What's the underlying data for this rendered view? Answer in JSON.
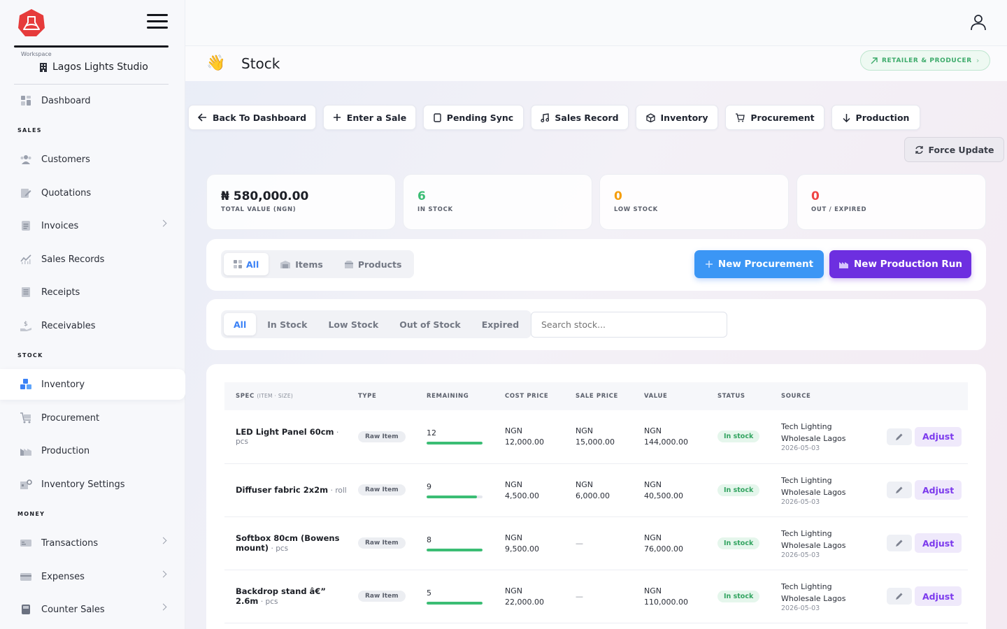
{
  "sidebar": {
    "workspace_caption": "Workspace",
    "workspace_name": "Lagos Lights Studio",
    "dashboard": "Dashboard",
    "sections": {
      "sales": "SALES",
      "stock": "STOCK",
      "money": "MONEY"
    },
    "items": {
      "customers": "Customers",
      "quotations": "Quotations",
      "invoices": "Invoices",
      "sales_records": "Sales Records",
      "receipts": "Receipts",
      "receivables": "Receivables",
      "inventory": "Inventory",
      "procurement": "Procurement",
      "production": "Production",
      "inventory_settings": "Inventory Settings",
      "transactions": "Transactions",
      "expenses": "Expenses",
      "counter_sales": "Counter Sales"
    }
  },
  "header": {
    "title": "Stock",
    "role_badge": "RETAILER & PRODUCER"
  },
  "toolbar": {
    "back": "Back To Dashboard",
    "enter_sale": "Enter a Sale",
    "pending_sync": "Pending Sync",
    "sales_record": "Sales Record",
    "inventory": "Inventory",
    "procurement": "Procurement",
    "production": "Production",
    "force_update": "Force Update"
  },
  "stats": {
    "total_value": {
      "value": "₦ 580,000.00",
      "label": "TOTAL VALUE (NGN)"
    },
    "in_stock": {
      "value": "6",
      "label": "IN STOCK"
    },
    "low_stock": {
      "value": "0",
      "label": "LOW STOCK"
    },
    "out_expired": {
      "value": "0",
      "label": "OUT / EXPIRED"
    }
  },
  "colors": {
    "in_stock": "#3bbd74",
    "low_stock": "#f59e0b",
    "out": "#ef4444",
    "accent": "#3b82f6",
    "purple": "#6d28d9"
  },
  "type_tabs": {
    "all": "All",
    "items": "Items",
    "products": "Products"
  },
  "actions": {
    "new_procurement": "New Procurement",
    "new_production_run": "New Production Run"
  },
  "status_tabs": {
    "all": "All",
    "in_stock": "In Stock",
    "low_stock": "Low Stock",
    "out_of_stock": "Out of Stock",
    "expired": "Expired"
  },
  "search": {
    "placeholder": "Search stock..."
  },
  "table": {
    "headers": {
      "spec": "SPEC",
      "spec_sub": "(ITEM · SIZE)",
      "type": "TYPE",
      "remaining": "REMAINING",
      "cost_price": "COST PRICE",
      "sale_price": "SALE PRICE",
      "value": "VALUE",
      "status": "STATUS",
      "source": "SOURCE"
    },
    "rows": [
      {
        "name": "LED Light Panel 60cm",
        "unit": "· pcs",
        "type": "Raw Item",
        "remaining": "12",
        "remaining_fill": 1.0,
        "cost_cur": "NGN",
        "cost": "12,000.00",
        "sale_cur": "NGN",
        "sale": "15,000.00",
        "value_cur": "NGN",
        "value": "144,000.00",
        "status": "In stock",
        "source_line1": "Tech Lighting",
        "source_line2": "Wholesale Lagos",
        "date": "2026-05-03",
        "adjust": "Adjust"
      },
      {
        "name": "Diffuser fabric 2x2m",
        "unit": "· roll",
        "type": "Raw Item",
        "remaining": "9",
        "remaining_fill": 0.9,
        "cost_cur": "NGN",
        "cost": "4,500.00",
        "sale_cur": "NGN",
        "sale": "6,000.00",
        "value_cur": "NGN",
        "value": "40,500.00",
        "status": "In stock",
        "source_line1": "Tech Lighting",
        "source_line2": "Wholesale Lagos",
        "date": "2026-05-03",
        "adjust": "Adjust"
      },
      {
        "name": "Softbox 80cm (Bowens",
        "name2": "mount)",
        "unit": "· pcs",
        "type": "Raw Item",
        "remaining": "8",
        "remaining_fill": 1.0,
        "cost_cur": "NGN",
        "cost": "9,500.00",
        "sale": "—",
        "value_cur": "NGN",
        "value": "76,000.00",
        "status": "In stock",
        "source_line1": "Tech Lighting",
        "source_line2": "Wholesale Lagos",
        "date": "2026-05-03",
        "adjust": "Adjust"
      },
      {
        "name": "Backdrop stand â€”",
        "name2": "2.6m",
        "unit": "· pcs",
        "type": "Raw Item",
        "remaining": "5",
        "remaining_fill": 1.0,
        "cost_cur": "NGN",
        "cost": "22,000.00",
        "sale": "—",
        "value_cur": "NGN",
        "value": "110,000.00",
        "status": "In stock",
        "source_line1": "Tech Lighting",
        "source_line2": "Wholesale Lagos",
        "date": "2026-05-03",
        "adjust": "Adjust"
      }
    ]
  }
}
